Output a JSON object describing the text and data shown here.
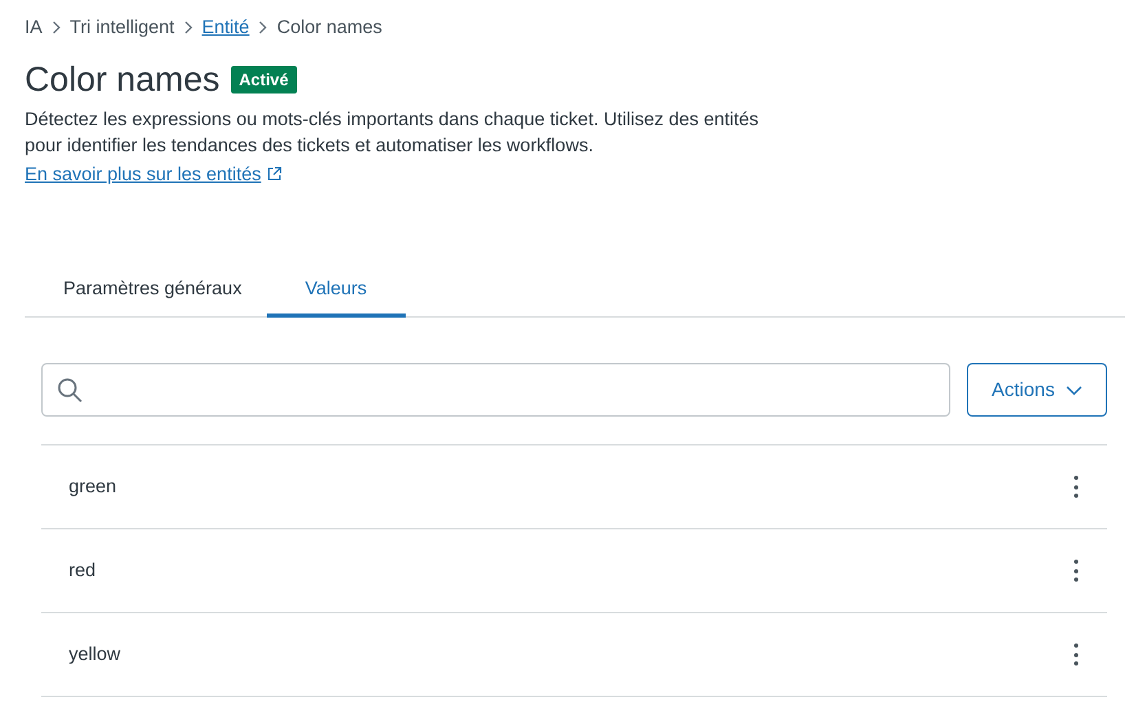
{
  "breadcrumb": [
    {
      "label": "IA",
      "kind": "text"
    },
    {
      "label": "Tri intelligent",
      "kind": "text"
    },
    {
      "label": "Entité",
      "kind": "link"
    },
    {
      "label": "Color names",
      "kind": "text"
    }
  ],
  "title": "Color names",
  "status_badge": "Activé",
  "description": "Détectez les expressions ou mots-clés importants dans chaque ticket. Utilisez des entités pour identifier les tendances des tickets et automatiser les workflows.",
  "learn_more_link": "En savoir plus sur les entités",
  "tabs": [
    {
      "label": "Paramètres généraux",
      "selected": false
    },
    {
      "label": "Valeurs",
      "selected": true
    }
  ],
  "actions_button": "Actions",
  "values": [
    {
      "name": "green"
    },
    {
      "name": "red"
    },
    {
      "name": "yellow"
    }
  ]
}
